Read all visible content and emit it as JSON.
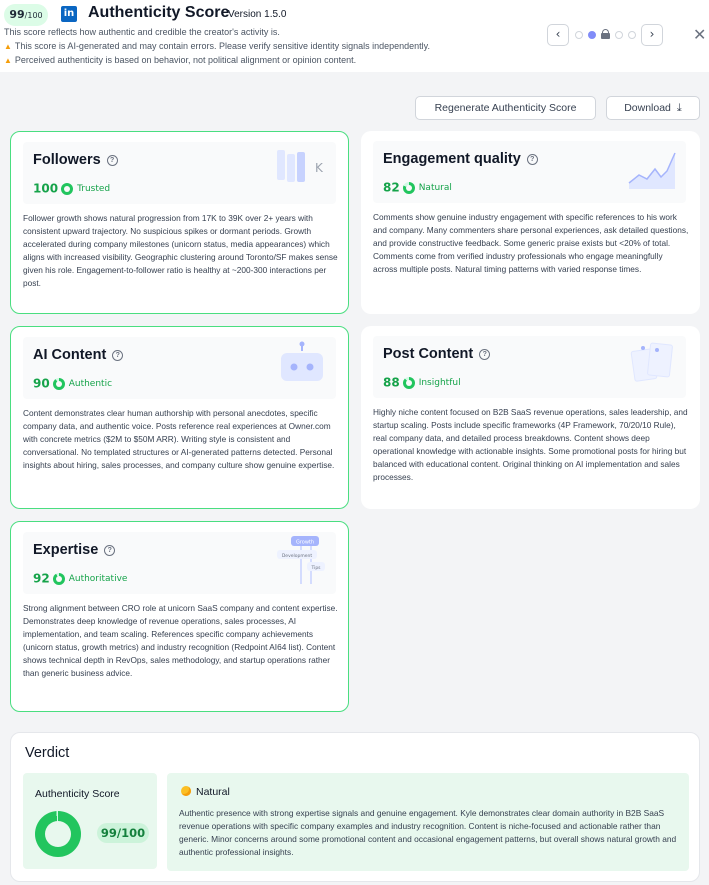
{
  "header": {
    "score_value": "99",
    "score_denominator": "/100",
    "logo_glyph": "in",
    "title": "Authenticity Score",
    "version": "Version 1.5.0",
    "subtitle": "This score reflects how authentic and credible the creator's activity is.",
    "warning_1": "This score is AI-generated and may contain errors. Please verify sensitive identity signals independently.",
    "warning_2": "Perceived authenticity is based on behavior, not political alignment or opinion content.",
    "prev_label": "‹",
    "next_label": "›",
    "close_label": "✕",
    "pager_active_index": 1
  },
  "actions": {
    "regenerate_label": "Regenerate Authenticity Score",
    "download_label": "Download"
  },
  "cards": {
    "followers": {
      "title": "Followers",
      "score": "100",
      "score_fraction": 1.0,
      "tag": "Trusted",
      "illustration_glyph": "K",
      "body": "Follower growth shows natural progression from 17K to 39K over 2+ years with consistent upward trajectory. No suspicious spikes or dormant periods. Growth accelerated during company milestones (unicorn status, media appearances) which aligns with increased visibility. Geographic clustering around Toronto/SF makes sense given his role. Engagement-to-follower ratio is healthy at ~200-300 interactions per post."
    },
    "engagement": {
      "title": "Engagement quality",
      "score": "82",
      "score_fraction": 0.82,
      "tag": "Natural",
      "body": "Comments show genuine industry engagement with specific references to his work and company. Many commenters share personal experiences, ask detailed questions, and provide constructive feedback. Some generic praise exists but <20% of total. Comments come from verified industry professionals who engage meaningfully across multiple posts. Natural timing patterns with varied response times."
    },
    "ai_content": {
      "title": "AI Content",
      "score": "90",
      "score_fraction": 0.9,
      "tag": "Authentic",
      "body": "Content demonstrates clear human authorship with personal anecdotes, specific company data, and authentic voice. Posts reference real experiences at Owner.com with concrete metrics ($2M to $50M ARR). Writing style is consistent and conversational. No templated structures or AI-generated patterns detected. Personal insights about hiring, sales processes, and company culture show genuine expertise."
    },
    "post_content": {
      "title": "Post Content",
      "score": "88",
      "score_fraction": 0.88,
      "tag": "Insightful",
      "body": "Highly niche content focused on B2B SaaS revenue operations, sales leadership, and startup scaling. Posts include specific frameworks (4P Framework, 70/20/10 Rule), real company data, and detailed process breakdowns. Content shows deep operational knowledge with actionable insights. Some promotional posts for hiring but balanced with educational content. Original thinking on AI implementation and sales processes."
    },
    "expertise": {
      "title": "Expertise",
      "score": "92",
      "score_fraction": 0.92,
      "tag": "Authoritative",
      "illustration_labels": [
        "Growth",
        "Development",
        "Tips"
      ],
      "body": "Strong alignment between CRO role at unicorn SaaS company and content expertise. Demonstrates deep knowledge of revenue operations, sales processes, AI implementation, and team scaling. References specific company achievements (unicorn status, growth metrics) and industry recognition (Redpoint AI64 list). Content shows technical depth in RevOps, sales methodology, and startup operations rather than generic business advice."
    }
  },
  "verdict": {
    "title": "Verdict",
    "score_label": "Authenticity Score",
    "score_text": "99/100",
    "score_fraction": 0.99,
    "tag": "Natural",
    "body": "Authentic presence with strong expertise signals and genuine engagement. Kyle demonstrates clear domain authority in B2B SaaS revenue operations with specific company examples and industry recognition. Content is niche-focused and actionable rather than generic. Minor concerns around some promotional content and occasional engagement patterns, but overall shows natural growth and authentic professional insights."
  },
  "colors": {
    "accent_green": "#22c55e",
    "text_green": "#16a34a",
    "card_border_green": "#4ade80",
    "pager_active": "#818cf8",
    "linkedin_blue": "#0a66c2",
    "warning_amber": "#f59e0b"
  },
  "icons": {
    "help": "question-circle-icon",
    "warning": "warning-triangle-icon",
    "download": "download-icon",
    "close": "close-icon",
    "lock": "lock-icon"
  }
}
